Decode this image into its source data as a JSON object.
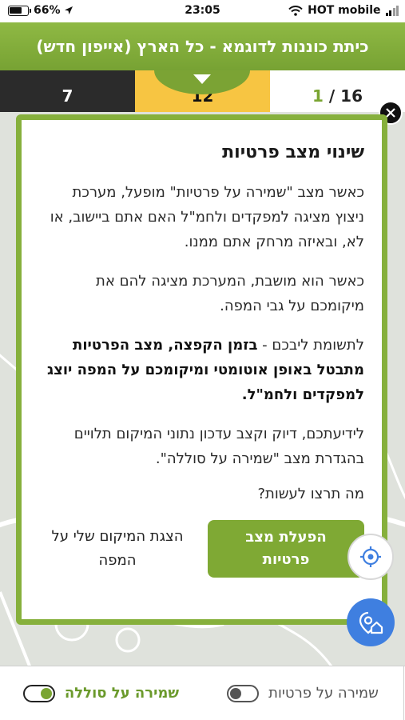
{
  "status_bar": {
    "battery": "66%",
    "time": "23:05",
    "carrier": "HOT mobile"
  },
  "header": {
    "title": "כיתת כוננות לדוגמא - כל הארץ (אייפון חדש)"
  },
  "tabs": {
    "left": "7",
    "middle": "12",
    "right_total": "16",
    "right_sep": " / ",
    "right_count": "1"
  },
  "modal": {
    "title": "שינוי מצב פרטיות",
    "paragraph1": "כאשר מצב \"שמירה על פרטיות\" מופעל, מערכת ניצוץ מציגה למפקדים ולחמ\"ל האם אתם ביישוב, או לא, ובאיזה מרחק אתם ממנו.",
    "paragraph2": "כאשר הוא מושבת, המערכת מציגה להם את מיקומכם על גבי המפה.",
    "paragraph3_intro": "לתשומת ליבכם - ",
    "paragraph3_bold": "בזמן הקפצה, מצב הפרטיות מתבטל באופן אוטומטי ומיקומכם על המפה יוצג למפקדים ולחמ\"ל.",
    "paragraph4": "לידיעתכם, דיוק וקצב עדכון נתוני המיקום תלויים בהגדרת מצב \"שמירה על סוללה\".",
    "question": "מה תרצו לעשות?",
    "primary_button": "הפעלת מצב פרטיות",
    "secondary_button": "הצגת המיקום שלי על המפה"
  },
  "bottom_bar": {
    "battery_saver_label": "שמירה על סוללה",
    "battery_saver_on": true,
    "privacy_label": "שמירה על פרטיות",
    "privacy_on": false
  },
  "icons": {
    "close": "close-icon",
    "locate": "crosshair-icon",
    "home_location": "home-pin-icon"
  },
  "colors": {
    "brand_green": "#7fa934",
    "tab_yellow": "#f7c542",
    "tab_dark": "#2b2b2b",
    "fab_blue": "#3f7fe0"
  }
}
